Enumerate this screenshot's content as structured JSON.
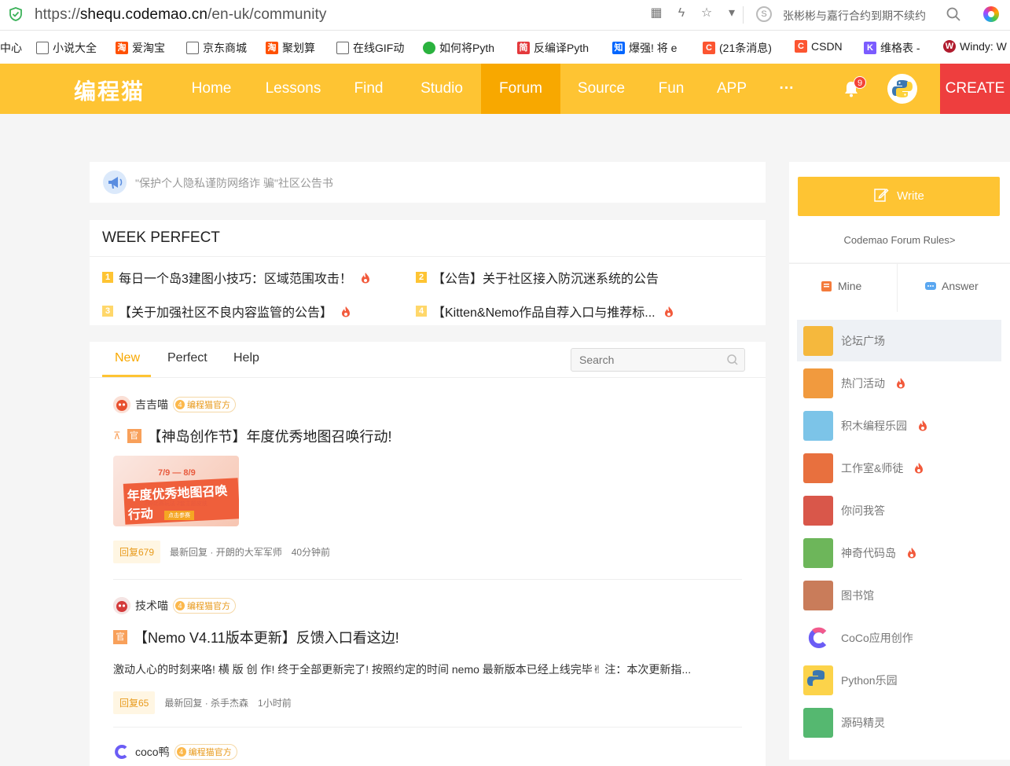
{
  "browser": {
    "url_prefix": "https://",
    "url_host": "shequ.codemao.cn",
    "url_path": "/en-uk/community",
    "search_suggestion": "张彬彬与嘉行合约到期不续约"
  },
  "bookmarks": [
    "中心",
    "小说大全",
    "爱淘宝",
    "京东商城",
    "聚划算",
    "在线GIF动",
    "如何将Pyth",
    "反编译Pyth",
    "爆强! 将 e",
    "(21条消息)",
    "CSDN",
    "维格表 -",
    "Windy: W"
  ],
  "bookmark_icon_chars": {
    "tao": "淘",
    "jian": "简",
    "zhi": "知",
    "csdn": "C",
    "wiki": "K",
    "windy": "W"
  },
  "nav": {
    "logo": "编程猫",
    "items": [
      "Home",
      "Lessons",
      "Find",
      "Studio",
      "Forum",
      "Source",
      "Fun",
      "APP",
      "···"
    ],
    "active": "Forum",
    "notifications": "9",
    "create": "CREATE"
  },
  "notice": {
    "text": "\"保护个人隐私谨防网络诈 骗\"社区公告书"
  },
  "week_perfect": {
    "title": "WEEK PERFECT",
    "items": [
      {
        "num": "1",
        "text": "每日一个岛3建图小技巧：区域范围攻击！"
      },
      {
        "num": "2",
        "text": "【公告】关于社区接入防沉迷系统的公告"
      },
      {
        "num": "3",
        "text": "【关于加强社区不良内容监管的公告】"
      },
      {
        "num": "4",
        "text": "【Kitten&Nemo作品自荐入口与推荐标..."
      }
    ]
  },
  "feed": {
    "tabs": [
      "New",
      "Perfect",
      "Help"
    ],
    "active_tab": "New",
    "search_placeholder": "Search",
    "official_tag": "编程猫官方",
    "official_level": "4",
    "guan_label": "官",
    "pin_label": "⊼",
    "posts": [
      {
        "author": "吉吉喵",
        "title": "【神岛创作节】年度优秀地图召唤行动!",
        "image_text": {
          "date": "7/9 — 8/9",
          "headline": "年度优秀地图召唤行动",
          "sub": "2种比赛玩法  2套主题皮肤",
          "button": "点击参赛"
        },
        "reply": "回复679",
        "last_reply": "最新回复 · 开朗的大军军师",
        "time": "40分钟前"
      },
      {
        "author": "技术喵",
        "title": "【Nemo V4.11版本更新】反馈入口看这边!",
        "excerpt": "激动人心的时刻来咯!    横 版 创 作!   终于全部更新完了!     按照约定的时间 nemo 最新版本已经上线完毕✌   注：本次更新指...",
        "reply": "回复65",
        "last_reply": "最新回复 · 杀手杰森",
        "time": "1小时前"
      },
      {
        "author": "coco鸭"
      }
    ]
  },
  "sidebar": {
    "write": "Write",
    "rules": "Codemao Forum Rules>",
    "mine": "Mine",
    "answer": "Answer",
    "boards": [
      {
        "label": "论坛广场",
        "hot": false,
        "color": "#f5b83d"
      },
      {
        "label": "热门活动",
        "hot": true,
        "color": "#f19a3e"
      },
      {
        "label": "积木编程乐园",
        "hot": true,
        "color": "#7cc4e8"
      },
      {
        "label": "工作室&师徒",
        "hot": true,
        "color": "#e8703e"
      },
      {
        "label": "你问我答",
        "hot": false,
        "color": "#d9574a"
      },
      {
        "label": "神奇代码岛",
        "hot": true,
        "color": "#6db65a"
      },
      {
        "label": "图书馆",
        "hot": false,
        "color": "#c97c5a"
      },
      {
        "label": "CoCo应用创作",
        "hot": false,
        "color": "#ffffff"
      },
      {
        "label": "Python乐园",
        "hot": false,
        "color": "#3f79b5"
      },
      {
        "label": "源码精灵",
        "hot": false,
        "color": "#55b870"
      }
    ]
  }
}
